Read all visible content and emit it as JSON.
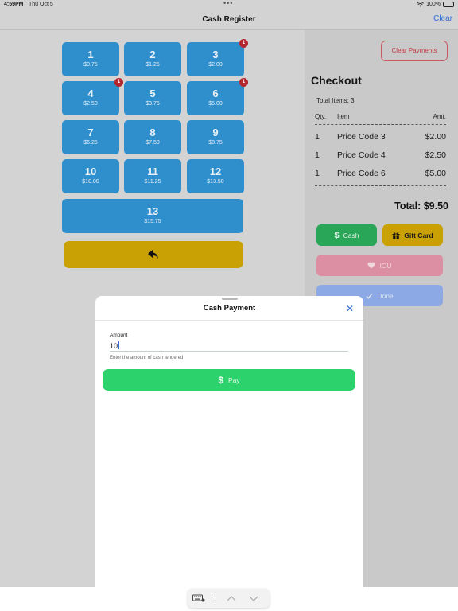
{
  "status_bar": {
    "time": "4:59PM",
    "date": "Thu Oct 5",
    "battery": "100%"
  },
  "nav": {
    "title": "Cash Register",
    "clear_label": "Clear"
  },
  "keypad": {
    "keys": [
      {
        "num": "1",
        "price": "$0.75",
        "badge": ""
      },
      {
        "num": "2",
        "price": "$1.25",
        "badge": ""
      },
      {
        "num": "3",
        "price": "$2.00",
        "badge": "1"
      },
      {
        "num": "4",
        "price": "$2.50",
        "badge": "1"
      },
      {
        "num": "5",
        "price": "$3.75",
        "badge": ""
      },
      {
        "num": "6",
        "price": "$5.00",
        "badge": "1"
      },
      {
        "num": "7",
        "price": "$6.25",
        "badge": ""
      },
      {
        "num": "8",
        "price": "$7.50",
        "badge": ""
      },
      {
        "num": "9",
        "price": "$8.75",
        "badge": ""
      },
      {
        "num": "10",
        "price": "$10.00",
        "badge": ""
      },
      {
        "num": "11",
        "price": "$11.25",
        "badge": ""
      },
      {
        "num": "12",
        "price": "$13.50",
        "badge": ""
      },
      {
        "num": "13",
        "price": "$15.75",
        "badge": ""
      }
    ],
    "back_icon": "undo-arrow-icon"
  },
  "checkout": {
    "clear_payments_label": "Clear Payments",
    "title": "Checkout",
    "total_items": "Total Items: 3",
    "columns": {
      "qty": "Qty.",
      "item": "Item",
      "amt": "Amt."
    },
    "rows": [
      {
        "qty": "1",
        "item": "Price Code 3",
        "amt": "$2.00"
      },
      {
        "qty": "1",
        "item": "Price Code 4",
        "amt": "$2.50"
      },
      {
        "qty": "1",
        "item": "Price Code 6",
        "amt": "$5.00"
      }
    ],
    "total": "Total: $9.50",
    "cash_label": "Cash",
    "gift_label": "Gift Card",
    "iou_label": "IOU",
    "done_label": "Done"
  },
  "sheet": {
    "title": "Cash Payment",
    "amount_label": "Amount",
    "amount_value": "10",
    "amount_help": "Enter the amount of cash tendered",
    "pay_label": "Pay"
  },
  "colors": {
    "key_blue": "#2f8fcd",
    "gold": "#c9a104",
    "cash_green": "#2aa659",
    "pay_green": "#2cd36c",
    "badge_red": "#b5262e",
    "link_blue": "#2f6fd6"
  }
}
